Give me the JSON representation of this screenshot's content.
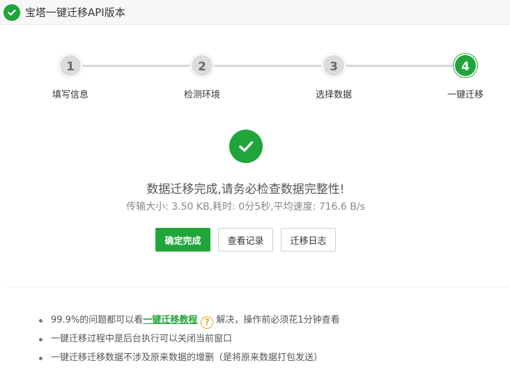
{
  "window": {
    "title": "宝塔一键迁移API版本",
    "logo_icon": "check-circle-icon"
  },
  "colors": {
    "accent": "#20a53a",
    "step_inactive": "#dcdcdc",
    "warning": "#f0a020"
  },
  "steps": [
    {
      "number": "1",
      "label": "填写信息",
      "active": false
    },
    {
      "number": "2",
      "label": "检测环境",
      "active": false
    },
    {
      "number": "3",
      "label": "选择数据",
      "active": false
    },
    {
      "number": "4",
      "label": "一键迁移",
      "active": true
    }
  ],
  "result": {
    "icon": "check-circle-icon",
    "title": "数据迁移完成,请务必检查数据完整性!",
    "info": "传输大小: 3.50 KB,耗时: 0分5秒,平均速度: 716.6 B/s"
  },
  "buttons": {
    "confirm": "确定完成",
    "view_records": "查看记录",
    "migration_log": "迁移日志"
  },
  "tips": {
    "tip1_prefix": "99.9%的问题都可以看",
    "tip1_link": "一键迁移教程",
    "tip1_icon": "question-icon",
    "tip1_suffix": "解决，操作前必须花1分钟查看",
    "tip2": "一键迁移过程中是后台执行可以关闭当前窗口",
    "tip3": "一键迁移迁移数据不涉及原来数据的增删（是将原来数据打包发送）"
  }
}
